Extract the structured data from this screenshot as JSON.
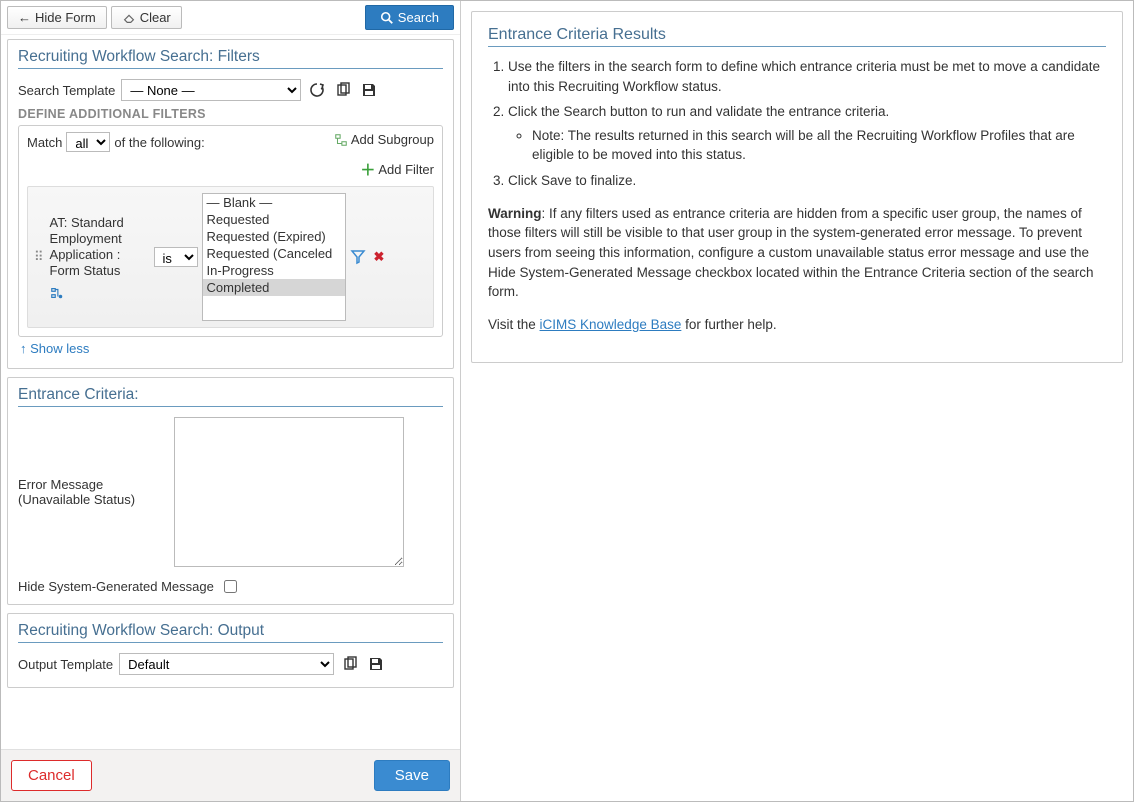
{
  "toolbar": {
    "hide_form": "Hide Form",
    "clear": "Clear",
    "search": "Search"
  },
  "filters_panel": {
    "title": "Recruiting Workflow Search: Filters",
    "search_template_label": "Search Template",
    "search_template_value": "— None —",
    "define_filters_heading": "DEFINE ADDITIONAL FILTERS",
    "match_prefix": "Match",
    "match_mode": "all",
    "match_suffix": "of the following:",
    "add_subgroup": "Add Subgroup",
    "add_filter": "Add Filter",
    "filter_field": "AT: Standard Employment Application : Form Status",
    "operator": "is",
    "values": [
      "— Blank —",
      "Requested",
      "Requested (Expired)",
      "Requested (Canceled",
      "In-Progress",
      "Completed"
    ],
    "selected_value_idx": 5,
    "show_less": "↑ Show less"
  },
  "entrance": {
    "title": "Entrance Criteria:",
    "error_label": "Error Message (Unavailable Status)",
    "error_value": "",
    "hide_msg_label": "Hide System-Generated Message",
    "hide_msg_checked": false
  },
  "output_panel": {
    "title": "Recruiting Workflow Search: Output",
    "output_template_label": "Output Template",
    "output_template_value": "Default"
  },
  "footer": {
    "cancel": "Cancel",
    "save": "Save"
  },
  "right": {
    "title": "Entrance Criteria Results",
    "li1": "Use the filters in the search form to define which entrance criteria must be met to move a candidate into this Recruiting Workflow status.",
    "li2": "Click the Search button to run and validate the entrance criteria.",
    "li2_note": "Note: The results returned in this search will be all the Recruiting Workflow Profiles that are eligible to be moved into this status.",
    "li3": "Click Save to finalize.",
    "warning_label": "Warning",
    "warning_text": ": If any filters used as entrance criteria are hidden from a specific user group, the names of those filters will still be visible to that user group in the system-generated error message. To prevent users from seeing this information, configure a custom unavailable status error message and use the Hide System-Generated Message checkbox located within the Entrance Criteria section of the search form.",
    "visit_prefix": "Visit the ",
    "visit_link": "iCIMS Knowledge Base",
    "visit_suffix": " for further help."
  }
}
